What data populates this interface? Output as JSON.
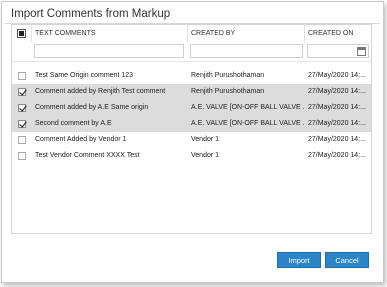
{
  "dialog": {
    "title": "Import Comments from Markup",
    "buttons": {
      "import": "Import",
      "cancel": "Cancel"
    }
  },
  "grid": {
    "columns": [
      "TEXT COMMENTS",
      "CREATED BY",
      "CREATED ON"
    ],
    "rows": [
      {
        "checked": false,
        "comment": "Test Same Origin comment 123",
        "created_by": "Renjith Purushothaman",
        "created_on": "27/May/2020 14:..."
      },
      {
        "checked": true,
        "comment": "Comment added by Renjith Test comment",
        "created_by": "Renjith Purushothaman",
        "created_on": "27/May/2020 14:..."
      },
      {
        "checked": true,
        "comment": "Comment added by A.E Same origin",
        "created_by": "A.E. VALVE [ON-OFF BALL VALVE ...",
        "created_on": "27/May/2020 14:..."
      },
      {
        "checked": true,
        "comment": "Second comment by A.E",
        "created_by": "A.E. VALVE [ON-OFF BALL VALVE ...",
        "created_on": "27/May/2020 14:..."
      },
      {
        "checked": false,
        "comment": "Comment Added by Vendor 1",
        "created_by": "Vendor 1",
        "created_on": "27/May/2020 14:..."
      },
      {
        "checked": false,
        "comment": "Test Vendor Comment XXXX Test",
        "created_by": "Vendor 1",
        "created_on": "27/May/2020 14:..."
      }
    ]
  },
  "icons": {
    "calendar": "calendar-icon",
    "checkbox": "checkbox"
  }
}
